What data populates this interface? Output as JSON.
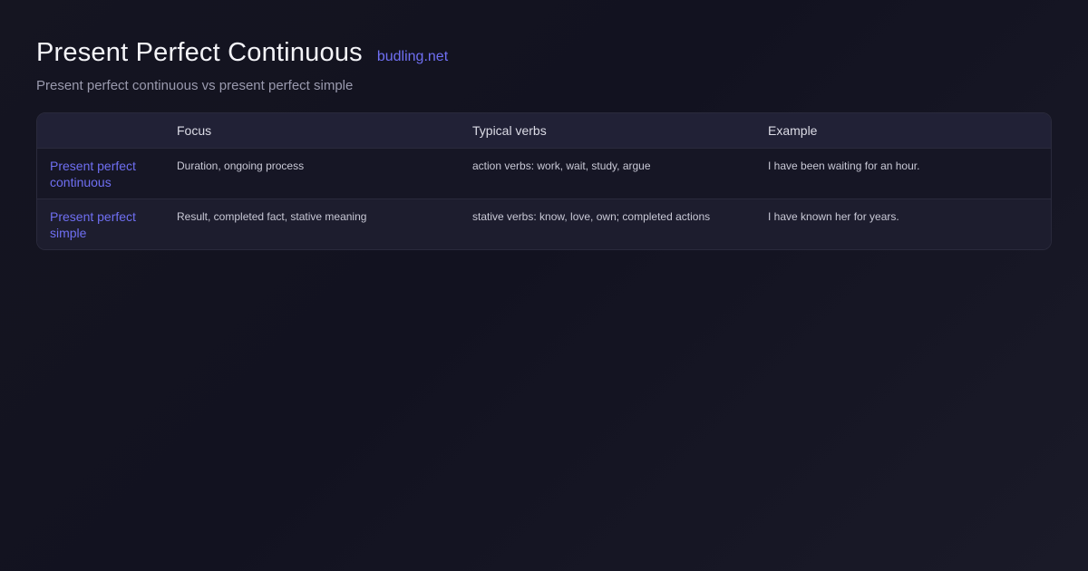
{
  "header": {
    "title": "Present Perfect Continuous",
    "brand": "budling.net",
    "subtitle": "Present perfect continuous vs present perfect simple"
  },
  "table": {
    "columns": [
      "",
      "Focus",
      "Typical verbs",
      "Example"
    ],
    "rows": [
      {
        "label": "Present perfect continuous",
        "focus": "Duration, ongoing process",
        "verbs": "action verbs: work, wait, study, argue",
        "example": "I have been waiting for an hour."
      },
      {
        "label": "Present perfect simple",
        "focus": "Result, completed fact, stative meaning",
        "verbs": "stative verbs: know, love, own; completed actions",
        "example": "I have known her for years."
      }
    ]
  },
  "colors": {
    "accent": "#6f6ff2",
    "background": "#151521",
    "header_row": "#212136"
  }
}
